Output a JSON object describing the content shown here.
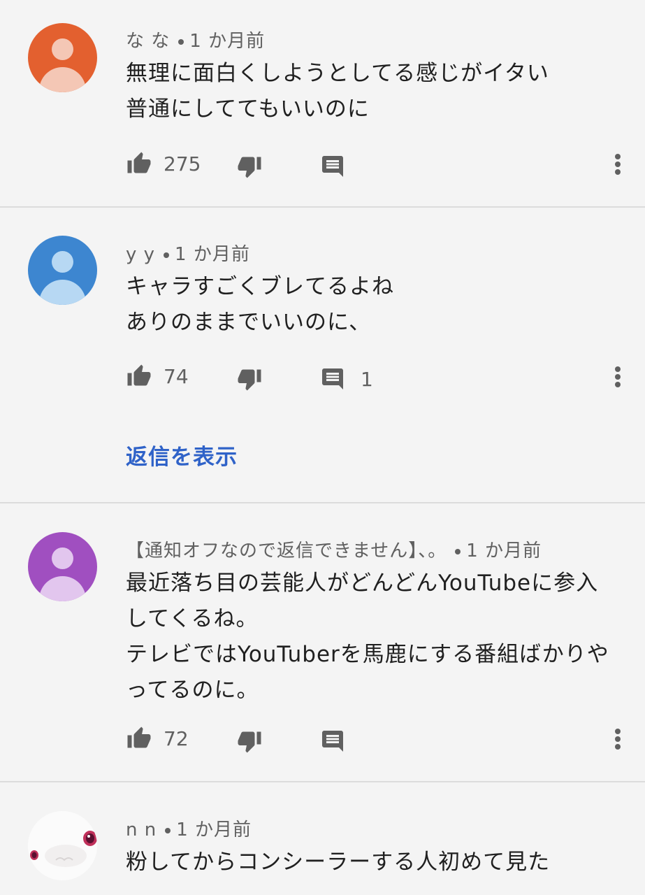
{
  "comments": [
    {
      "author": "な な",
      "time": "1 か月前",
      "avatar_color": "#e3602f",
      "lines": [
        "無理に面白くしようとしてる感じがイタい",
        "普通にしててもいいのに"
      ],
      "likes": "275",
      "replies": ""
    },
    {
      "author": "y y",
      "time": "1 か月前",
      "avatar_color": "#3d86d0",
      "lines": [
        "キャラすごくブレてるよね",
        "ありのままでいいのに、"
      ],
      "likes": "74",
      "replies": "1",
      "view_replies_label": "返信を表示"
    },
    {
      "author": "【通知オフなので返信できません】、。",
      "time": "1 か月前",
      "avatar_color": "#a04fc0",
      "lines": [
        "最近落ち目の芸能人がどんどんYouTubeに参入",
        "してくるね。",
        "テレビではYouTuberを馬鹿にする番組ばかりや",
        "ってるのに。"
      ],
      "likes": "72",
      "replies": ""
    },
    {
      "author": "n n",
      "time": "1 か月前",
      "lines": [
        "粉してからコンシーラーする人初めて見た"
      ]
    }
  ],
  "icons": {
    "like": "thumb-up-icon",
    "dislike": "thumb-down-icon",
    "reply": "comment-icon",
    "more": "more-vert-icon"
  },
  "colors": {
    "link": "#2f62c8",
    "meta": "#606060",
    "background": "#f4f4f4"
  }
}
